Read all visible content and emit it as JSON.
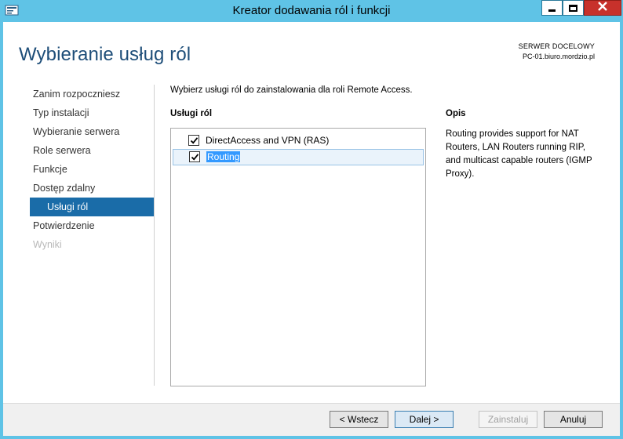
{
  "window": {
    "title": "Kreator dodawania ról i funkcji",
    "close_label": "X"
  },
  "header": {
    "page_title": "Wybieranie usług ról",
    "server_label": "SERWER DOCELOWY",
    "server_name": "PC-01.biuro.mordzio.pl"
  },
  "nav": {
    "items": [
      {
        "label": "Zanim rozpoczniesz",
        "state": "normal"
      },
      {
        "label": "Typ instalacji",
        "state": "normal"
      },
      {
        "label": "Wybieranie serwera",
        "state": "normal"
      },
      {
        "label": "Role serwera",
        "state": "normal"
      },
      {
        "label": "Funkcje",
        "state": "normal"
      },
      {
        "label": "Dostęp zdalny",
        "state": "normal"
      },
      {
        "label": "Usługi ról",
        "state": "active"
      },
      {
        "label": "Potwierdzenie",
        "state": "normal"
      },
      {
        "label": "Wyniki",
        "state": "disabled"
      }
    ]
  },
  "main": {
    "instruction": "Wybierz usługi ról do zainstalowania dla roli Remote Access.",
    "services_label": "Usługi ról",
    "services": [
      {
        "label": "DirectAccess and VPN (RAS)",
        "checked": true
      },
      {
        "label": "Routing",
        "checked": true
      }
    ],
    "description_label": "Opis",
    "description": "Routing provides support for NAT Routers, LAN Routers running RIP, and multicast capable routers (IGMP Proxy)."
  },
  "footer": {
    "back": "< Wstecz",
    "next": "Dalej >",
    "install": "Zainstaluj",
    "cancel": "Anuluj"
  },
  "colors": {
    "frame": "#5fc3e6",
    "accent": "#1a6ca8",
    "title": "#1e4e79",
    "close": "#c7312b"
  }
}
